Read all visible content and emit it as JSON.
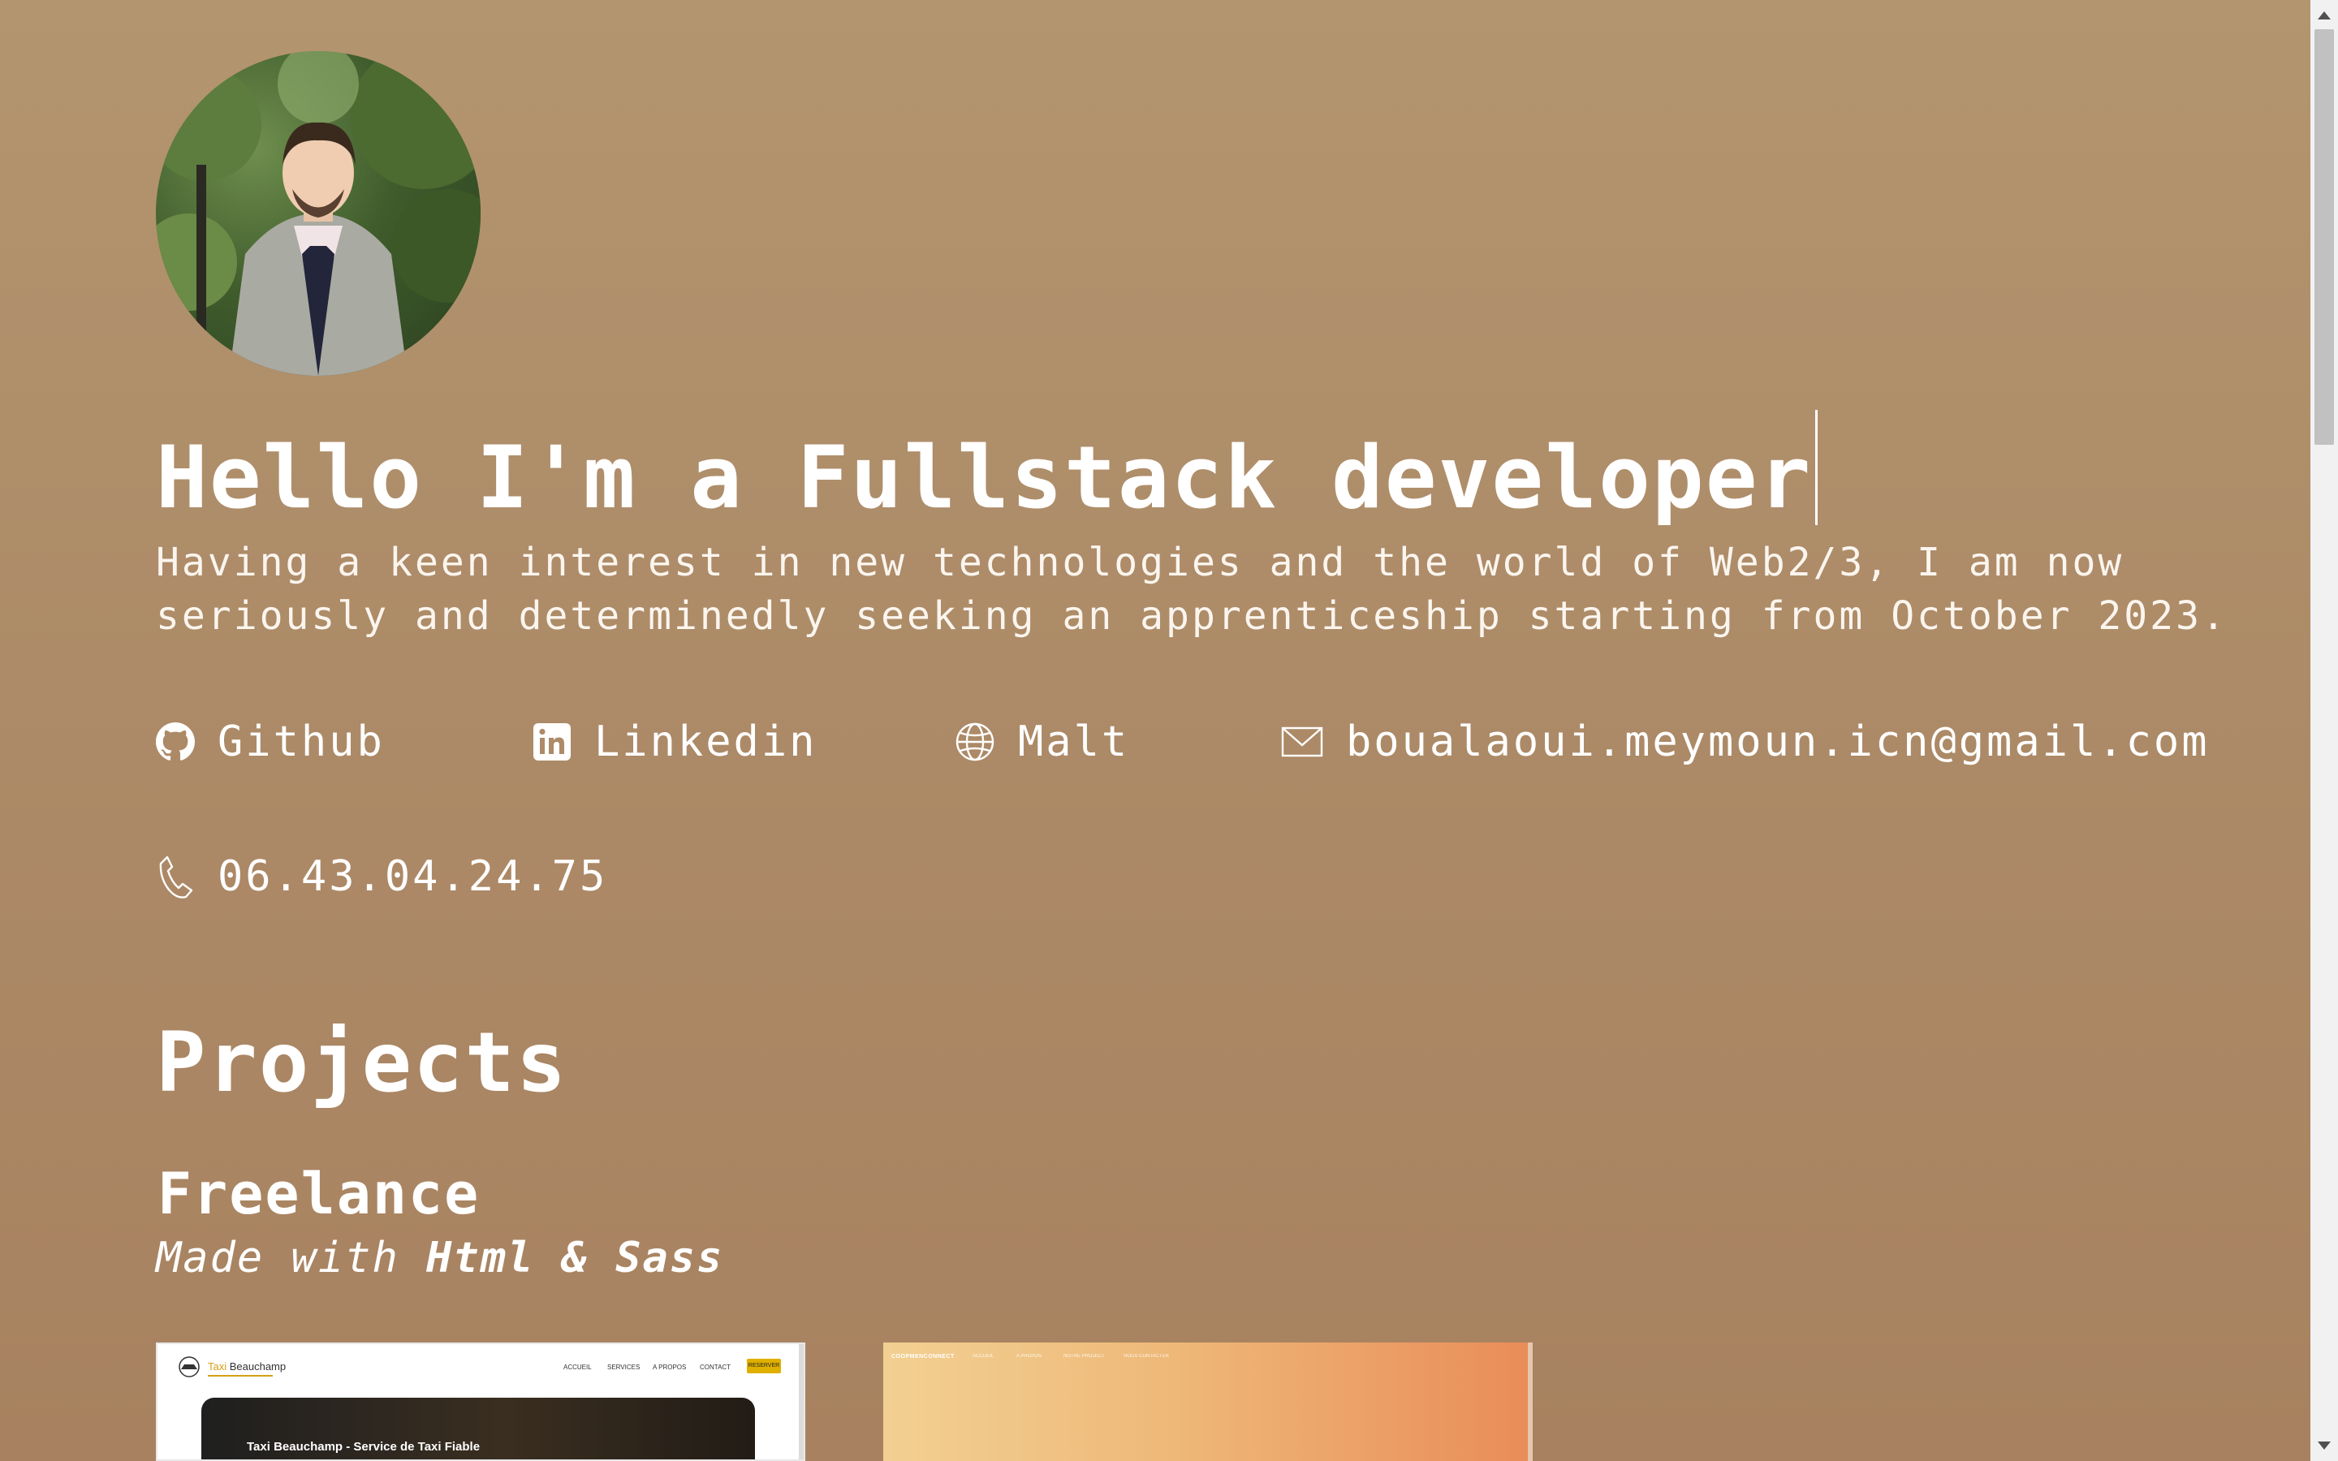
{
  "hero": {
    "headline": "Hello I'm a Fullstack developer",
    "intro": "Having a keen interest in new technologies and the world of Web2/3, I am now seriously and determinedly seeking an apprenticeship starting from October 2023."
  },
  "contacts": {
    "github": "Github",
    "linkedin": "Linkedin",
    "malt": "Malt",
    "email": "boualaoui.meymoun.icn@gmail.com",
    "phone": "06.43.04.24.75"
  },
  "projects": {
    "title": "Projects",
    "freelance_title": "Freelance",
    "made_with_prefix": "Made with",
    "made_with_tech": "Html & Sass",
    "cards": [
      {
        "brand_accent": "Taxi",
        "brand_rest": " Beauchamp",
        "menu": [
          "ACCUEIL",
          "SERVICES",
          "A PROPOS",
          "CONTACT"
        ],
        "cta": "RESERVER",
        "hero_title": "Taxi Beauchamp - Service de Taxi Fiable"
      },
      {
        "brand": "COOPMENCONNECT",
        "menu": [
          "ACCUEIL",
          "A PROPOS",
          "NOTRE PROJECT",
          "NOUS CONTACTER"
        ]
      }
    ]
  },
  "colors": {
    "background_top": "#b3956f",
    "background_bottom": "#a88260",
    "text": "#ffffff"
  },
  "icons": [
    "github-icon",
    "linkedin-icon",
    "globe-icon",
    "mail-icon",
    "phone-icon"
  ]
}
